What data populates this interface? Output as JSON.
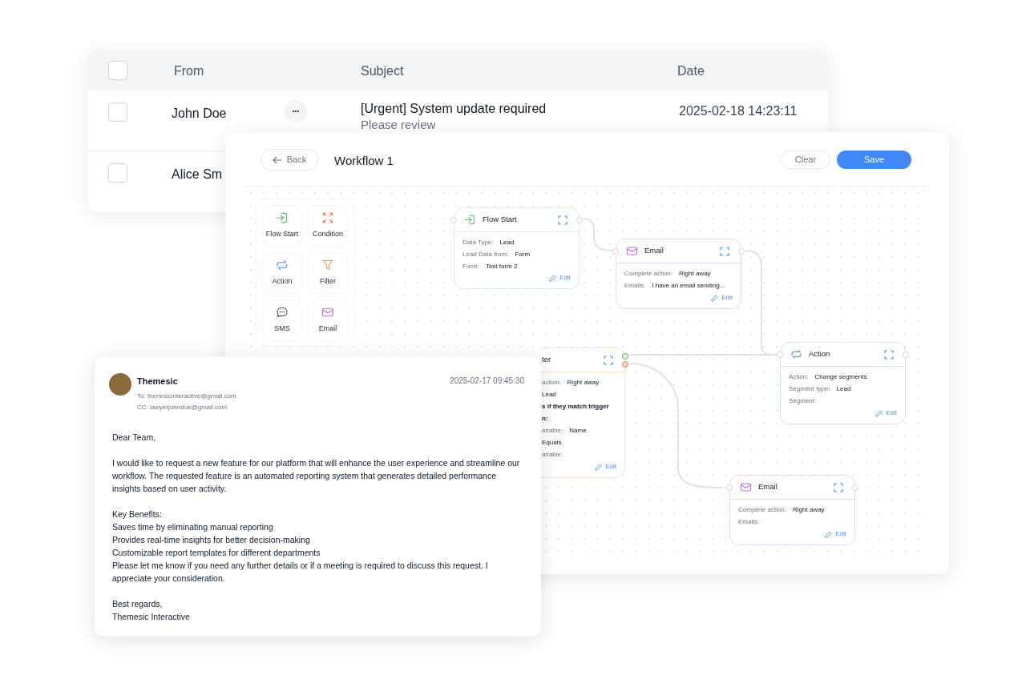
{
  "inbox_table": {
    "select_all": {
      "checked": false
    },
    "columns": [
      "From",
      "Subject",
      "Date"
    ],
    "rows": [
      {
        "checked": false,
        "from": "John Doe",
        "more": "•••",
        "subject": "[Urgent] System update required",
        "preview": "Please review",
        "date": "2025-02-18 14:23:11"
      },
      {
        "checked": false,
        "from": "Alice Sm"
      }
    ]
  },
  "workflow": {
    "back": "Back",
    "title": "Workflow 1",
    "clear": "Clear",
    "save": "Save",
    "palette": [
      {
        "kind": "start",
        "label": "Flow Start"
      },
      {
        "kind": "condition",
        "label": "Condition"
      },
      {
        "kind": "action",
        "label": "Action"
      },
      {
        "kind": "filter",
        "label": "Filter"
      },
      {
        "kind": "sms",
        "label": "SMS"
      },
      {
        "kind": "email",
        "label": "Email"
      }
    ],
    "nodes": [
      {
        "kind": "start",
        "title": "Flow Start",
        "fields": [
          {
            "label": "Data Type:",
            "value": "Lead"
          },
          {
            "label": "Lead Data from:",
            "value": "Form"
          },
          {
            "label": "Form:",
            "value": "Test form 2"
          }
        ],
        "edit": "Edit"
      },
      {
        "kind": "email",
        "title": "Email",
        "fields": [
          {
            "label": "Complete action:",
            "value": "Right away"
          },
          {
            "label": "Emails:",
            "value": "I have an email sending..."
          }
        ],
        "edit": "Edit"
      },
      {
        "kind": "filter",
        "title": "ter",
        "fields": [
          {
            "label": "action:",
            "value": "Right away"
          },
          {
            "value": "Lead"
          },
          {
            "strong": "s if they match trigger"
          },
          {
            "strong": "n:"
          },
          {
            "label": "ariable:",
            "value": "Name"
          },
          {
            "value": "Equals"
          },
          {
            "label": "ariable:"
          }
        ],
        "edit": "Edit"
      },
      {
        "kind": "action",
        "title": "Action",
        "fields": [
          {
            "label": "Action:",
            "value": "Change segments"
          },
          {
            "label": "Segment type:",
            "value": "Lead"
          },
          {
            "label": "Segment:"
          }
        ],
        "edit": "Edit"
      },
      {
        "kind": "email",
        "title": "Email",
        "fields": [
          {
            "label": "Complete action:",
            "value": "Right away"
          },
          {
            "label": "Emails:"
          }
        ],
        "edit": "Edit"
      }
    ]
  },
  "email": {
    "sender": "Themesic",
    "to": "To: thenesicinteractive@gmail.com",
    "cc": "CC: lawyerjohndoe@gmail.com",
    "date": "2025-02-17 09:45:30",
    "paragraphs": [
      [
        "Dear Team,"
      ],
      [
        "I would like to request a new feature for our platform that will enhance the user experience and streamline our workflow. The requested feature is an automated reporting system that generates detailed performance insights based on user activity."
      ],
      [
        "Key Benefits:",
        "Saves time by eliminating manual reporting",
        "Provides real-time insights for better decision-making",
        "Customizable report templates for different departments",
        "Please let me know if you need any further details or if a meeting is required to discuss this request. I appreciate your consideration."
      ],
      [
        "Best regards,",
        "Themesic Interactive"
      ]
    ]
  }
}
